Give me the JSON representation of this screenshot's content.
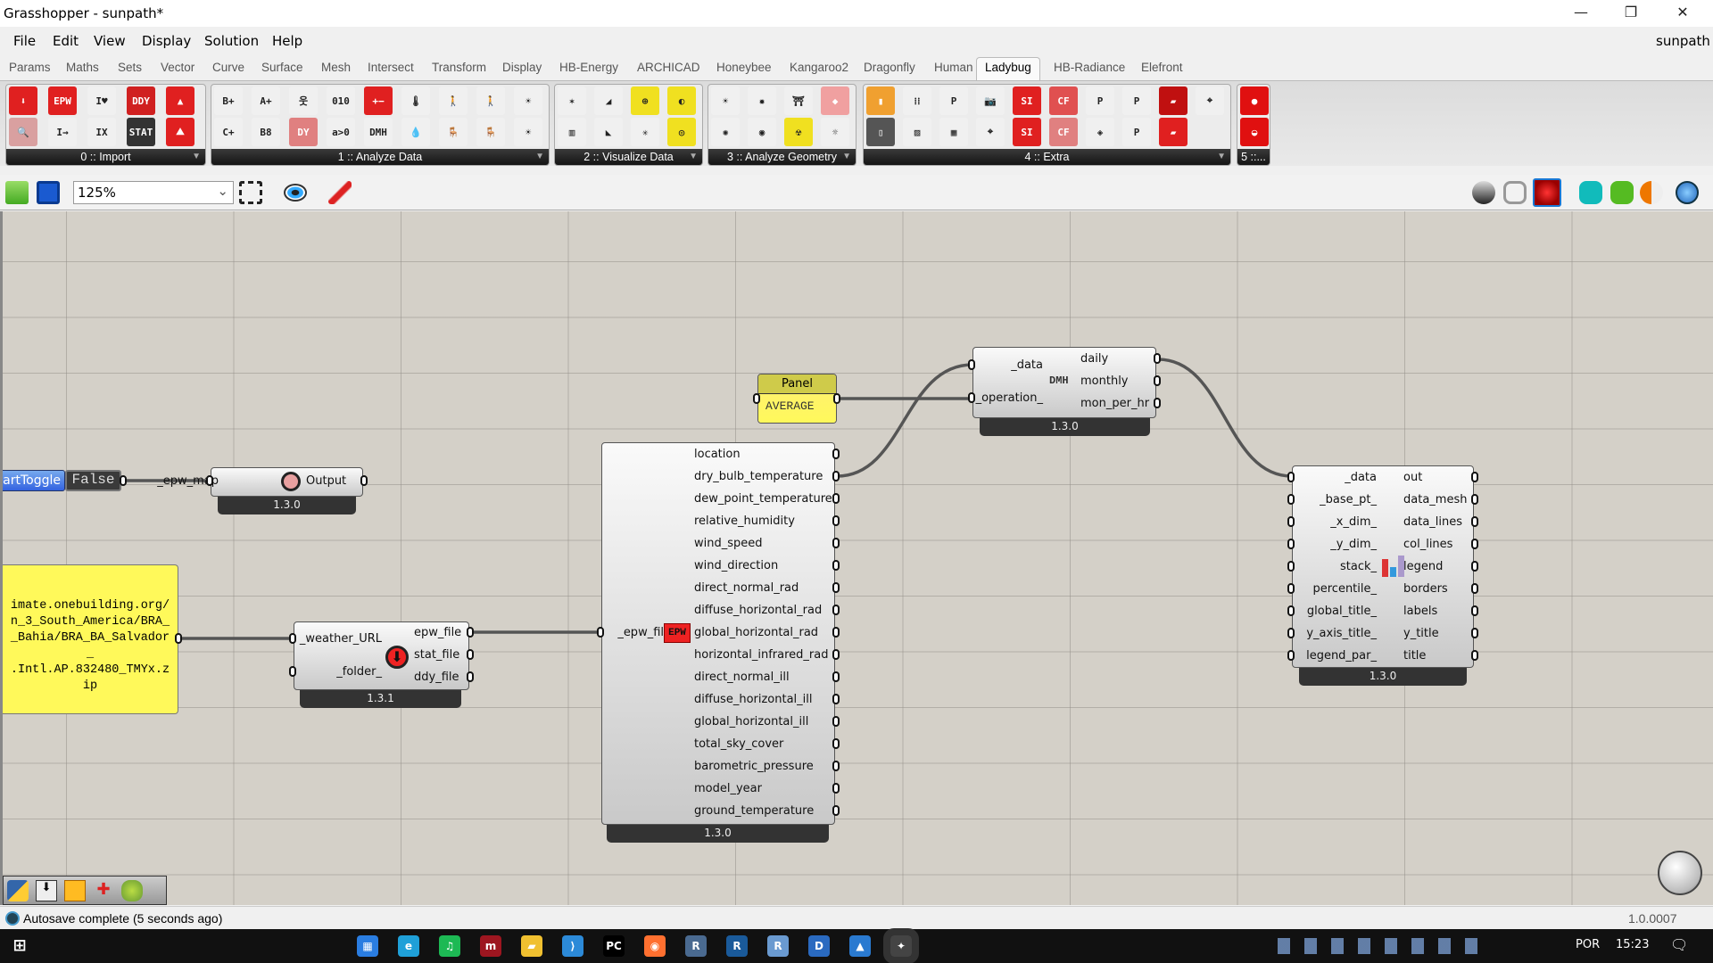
{
  "window": {
    "title": "Grasshopper - sunpath*",
    "user": "sunpath",
    "minimize": "—",
    "restore": "❐",
    "close": "✕"
  },
  "menu": [
    "File",
    "Edit",
    "View",
    "Display",
    "Solution",
    "Help"
  ],
  "tabs": [
    "Params",
    "Maths",
    "Sets",
    "Vector",
    "Curve",
    "Surface",
    "Mesh",
    "Intersect",
    "Transform",
    "Display",
    "HB-Energy",
    "ARCHICAD",
    "Honeybee",
    "Kangaroo2",
    "Dragonfly",
    "Human",
    "Ladybug",
    "HB-Radiance",
    "Elefront"
  ],
  "active_tab": "Ladybug",
  "ribbon_groups": [
    {
      "label": "0 :: Import",
      "icons": [
        [
          "download-weather-icon",
          "#e02020",
          "⬇"
        ],
        [
          "search-icon",
          "#d9a0a0",
          "🔍"
        ],
        [
          "epw-icon",
          "#e02020",
          "EPW"
        ],
        [
          "epw-to-ny-icon",
          "#f0f0f0",
          "I→"
        ],
        [
          "i-love-ny-icon",
          "#f0f0f0",
          "I♥"
        ],
        [
          "ix-ny-icon",
          "#f0f0f0",
          "IX"
        ],
        [
          "ddy-icon",
          "#d02020",
          "DDY"
        ],
        [
          "stat-icon",
          "#333333",
          "STAT"
        ],
        [
          "red-triangle-icon",
          "#e02020",
          "▲"
        ],
        [
          "mountain-icon",
          "#e02020",
          "⛰"
        ]
      ]
    },
    {
      "label": "1 :: Analyze Data",
      "icons": [
        [
          "add-data-icon",
          "#f0f0f0",
          "B+"
        ],
        [
          "c-plus-icon",
          "#f0f0f0",
          "C+"
        ],
        [
          "a-b-icon",
          "#f0f0f0",
          "A+"
        ],
        [
          "b8-a2-icon",
          "#f0f0f0",
          "B8"
        ],
        [
          "person-icon",
          "#f0f0f0",
          "웃"
        ],
        [
          "dy-icon",
          "#e08080",
          "DY"
        ],
        [
          "binary-icon",
          "#f0f0f0",
          "010"
        ],
        [
          "a-gt-0-icon",
          "#f0f0f0",
          "a>0"
        ],
        [
          "math-ops-icon",
          "#e02020",
          "+−"
        ],
        [
          "dmh-icon",
          "#f0f0f0",
          "DMH"
        ],
        [
          "thermometer-icon",
          "#f0f0f0",
          "🌡"
        ],
        [
          "humidity-icon",
          "#f0f0f0",
          "💧"
        ],
        [
          "thermal-person-icon",
          "#f0f0f0",
          "🚶"
        ],
        [
          "indoor-comfort-icon",
          "#f0f0f0",
          "🪑"
        ],
        [
          "walking-comfort-icon",
          "#f0f0f0",
          "🚶"
        ],
        [
          "seated-icon",
          "#f0f0f0",
          "🪑"
        ],
        [
          "sitting-sun-icon",
          "#f0f0f0",
          "☀"
        ],
        [
          "standing-sun-icon",
          "#f0f0f0",
          "☀"
        ]
      ]
    },
    {
      "label": "2 :: Visualize Data",
      "icons": [
        [
          "wind-rose-icon",
          "#f0f0f0",
          "✶"
        ],
        [
          "bar-chart-icon",
          "#f0f0f0",
          "▥"
        ],
        [
          "psych-chart-icon",
          "#f0f0f0",
          "◢"
        ],
        [
          "adaptive-chart-icon",
          "#f0f0f0",
          "◣"
        ],
        [
          "sunpath-icon",
          "#f0e020",
          "⊕"
        ],
        [
          "shrink-icon",
          "#f0f0f0",
          "✳"
        ],
        [
          "sky-dome-icon",
          "#f0e020",
          "◐"
        ],
        [
          "radiation-dome-icon",
          "#f0e020",
          "◎"
        ]
      ]
    },
    {
      "label": "3 :: Analyze Geometry",
      "icons": [
        [
          "sun-icon",
          "#f0f0f0",
          "☀"
        ],
        [
          "orange-sun-icon",
          "#f0f0f0",
          "✺"
        ],
        [
          "view-rose-icon",
          "#f0f0f0",
          "✹"
        ],
        [
          "eye-icon",
          "#f0f0f0",
          "◉"
        ],
        [
          "human-view-icon",
          "#f0f0f0",
          "⛩"
        ],
        [
          "radiation-icon",
          "#f0e020",
          "☢"
        ],
        [
          "shade-icon",
          "#f0a0a0",
          "◆"
        ],
        [
          "sun-eye-icon",
          "#f0f0f0",
          "☼"
        ]
      ]
    },
    {
      "label": "4 :: Extra",
      "icons": [
        [
          "gradient-icon",
          "#f0a030",
          "▮"
        ],
        [
          "toggle-icon",
          "#555555",
          "▯"
        ],
        [
          "dots-icon",
          "#f0f0f0",
          "⁞⁞"
        ],
        [
          "image-icon",
          "#f0f0f0",
          "▨"
        ],
        [
          "legend-par-icon",
          "#f0f0f0",
          "P"
        ],
        [
          "color-range-icon",
          "#f0f0f0",
          "▦"
        ],
        [
          "camera-icon",
          "#f0f0f0",
          "📷"
        ],
        [
          "capture-icon",
          "#f0f0f0",
          "⌖"
        ],
        [
          "si-ip-icon",
          "#e02020",
          "SI"
        ],
        [
          "si-ip-2-icon",
          "#e02020",
          "SI"
        ],
        [
          "c-f-icon",
          "#e05050",
          "CF"
        ],
        [
          "c-f-2-icon",
          "#e08080",
          "CF"
        ],
        [
          "person-p-icon",
          "#f0f0f0",
          "P"
        ],
        [
          "sensor-icon",
          "#f0f0f0",
          "◈"
        ],
        [
          "seated-p-icon",
          "#f0f0f0",
          "P"
        ],
        [
          "standing-p-icon",
          "#f0f0f0",
          "P"
        ],
        [
          "folder-icon",
          "#c01010",
          "▰"
        ],
        [
          "open-folder-icon",
          "#e02020",
          "▰"
        ],
        [
          "crosshair-icon",
          "#f0f0f0",
          "⌖"
        ]
      ]
    },
    {
      "label": "5 ::...",
      "icons": [
        [
          "ladybug-icon",
          "#e01010",
          "●"
        ],
        [
          "ladybug-update-icon",
          "#e01010",
          "◒"
        ]
      ]
    }
  ],
  "toolbar": {
    "zoom": "125%",
    "zoom_arrow": "⌄"
  },
  "canvas": {
    "toggle": {
      "label": "artToggle",
      "value": "False"
    },
    "yellow_panel": {
      "text": "imate.onebuilding.org/\nn_3_South_America/BRA_\n_Bahia/BRA_BA_Salvador\n_\n.Intl.AP.832480_TMYx.z\nip"
    },
    "epw_map": {
      "inputs": [
        "_epw_map"
      ],
      "outputs": [
        "Output"
      ],
      "version": "1.3.0"
    },
    "download_weather": {
      "inputs": [
        "_weather_URL",
        "_folder_"
      ],
      "outputs": [
        "epw_file",
        "stat_file",
        "ddy_file"
      ],
      "version": "1.3.1"
    },
    "import_epw": {
      "inputs": [
        "_epw_file"
      ],
      "outputs": [
        "location",
        "dry_bulb_temperature",
        "dew_point_temperature",
        "relative_humidity",
        "wind_speed",
        "wind_direction",
        "direct_normal_rad",
        "diffuse_horizontal_rad",
        "global_horizontal_rad",
        "horizontal_infrared_rad",
        "direct_normal_ill",
        "diffuse_horizontal_ill",
        "global_horizontal_ill",
        "total_sky_cover",
        "barometric_pressure",
        "model_year",
        "ground_temperature"
      ],
      "version": "1.3.0",
      "icon_text": "EPW"
    },
    "panel": {
      "title": "Panel",
      "value": "AVERAGE"
    },
    "dmh": {
      "inputs": [
        "_data",
        "_operation_"
      ],
      "outputs": [
        "daily",
        "monthly",
        "mon_per_hr"
      ],
      "version": "1.3.0",
      "icon_text": "DMH"
    },
    "monthly_chart": {
      "inputs": [
        "_data",
        "_base_pt_",
        "_x_dim_",
        "_y_dim_",
        "stack_",
        "percentile_",
        "global_title_",
        "y_axis_title_",
        "legend_par_"
      ],
      "outputs": [
        "out",
        "data_mesh",
        "data_lines",
        "col_lines",
        "legend",
        "borders",
        "labels",
        "y_title",
        "title"
      ],
      "version": "1.3.0"
    }
  },
  "status": {
    "message": "Autosave complete (5 seconds ago)",
    "version": "1.0.0007"
  },
  "taskbar": {
    "apps": [
      [
        "ms-store-icon",
        "#2a7de1",
        "▦"
      ],
      [
        "edge-icon",
        "#1fa0d8",
        "e"
      ],
      [
        "spotify-icon",
        "#1db954",
        "♫"
      ],
      [
        "mendeley-icon",
        "#9d1620",
        "m"
      ],
      [
        "file-explorer-icon",
        "#f0c030",
        "▰"
      ],
      [
        "vscode-icon",
        "#2c8ad8",
        "⟩"
      ],
      [
        "pycharm-icon",
        "#000000",
        "PC"
      ],
      [
        "firefox-icon",
        "#ff7030",
        "◉"
      ],
      [
        "rhino-icon",
        "#4a6a90",
        "R"
      ],
      [
        "revit-icon",
        "#1a5a9a",
        "R"
      ],
      [
        "rstudio-icon",
        "#6a9ad0",
        "R"
      ],
      [
        "dynamo-icon",
        "#2a6ac0",
        "D"
      ],
      [
        "photos-icon",
        "#2a7ad0",
        "▲"
      ],
      [
        "grasshopper-icon",
        "#444444",
        "✦"
      ]
    ],
    "lang": "POR",
    "time": "15:23"
  }
}
